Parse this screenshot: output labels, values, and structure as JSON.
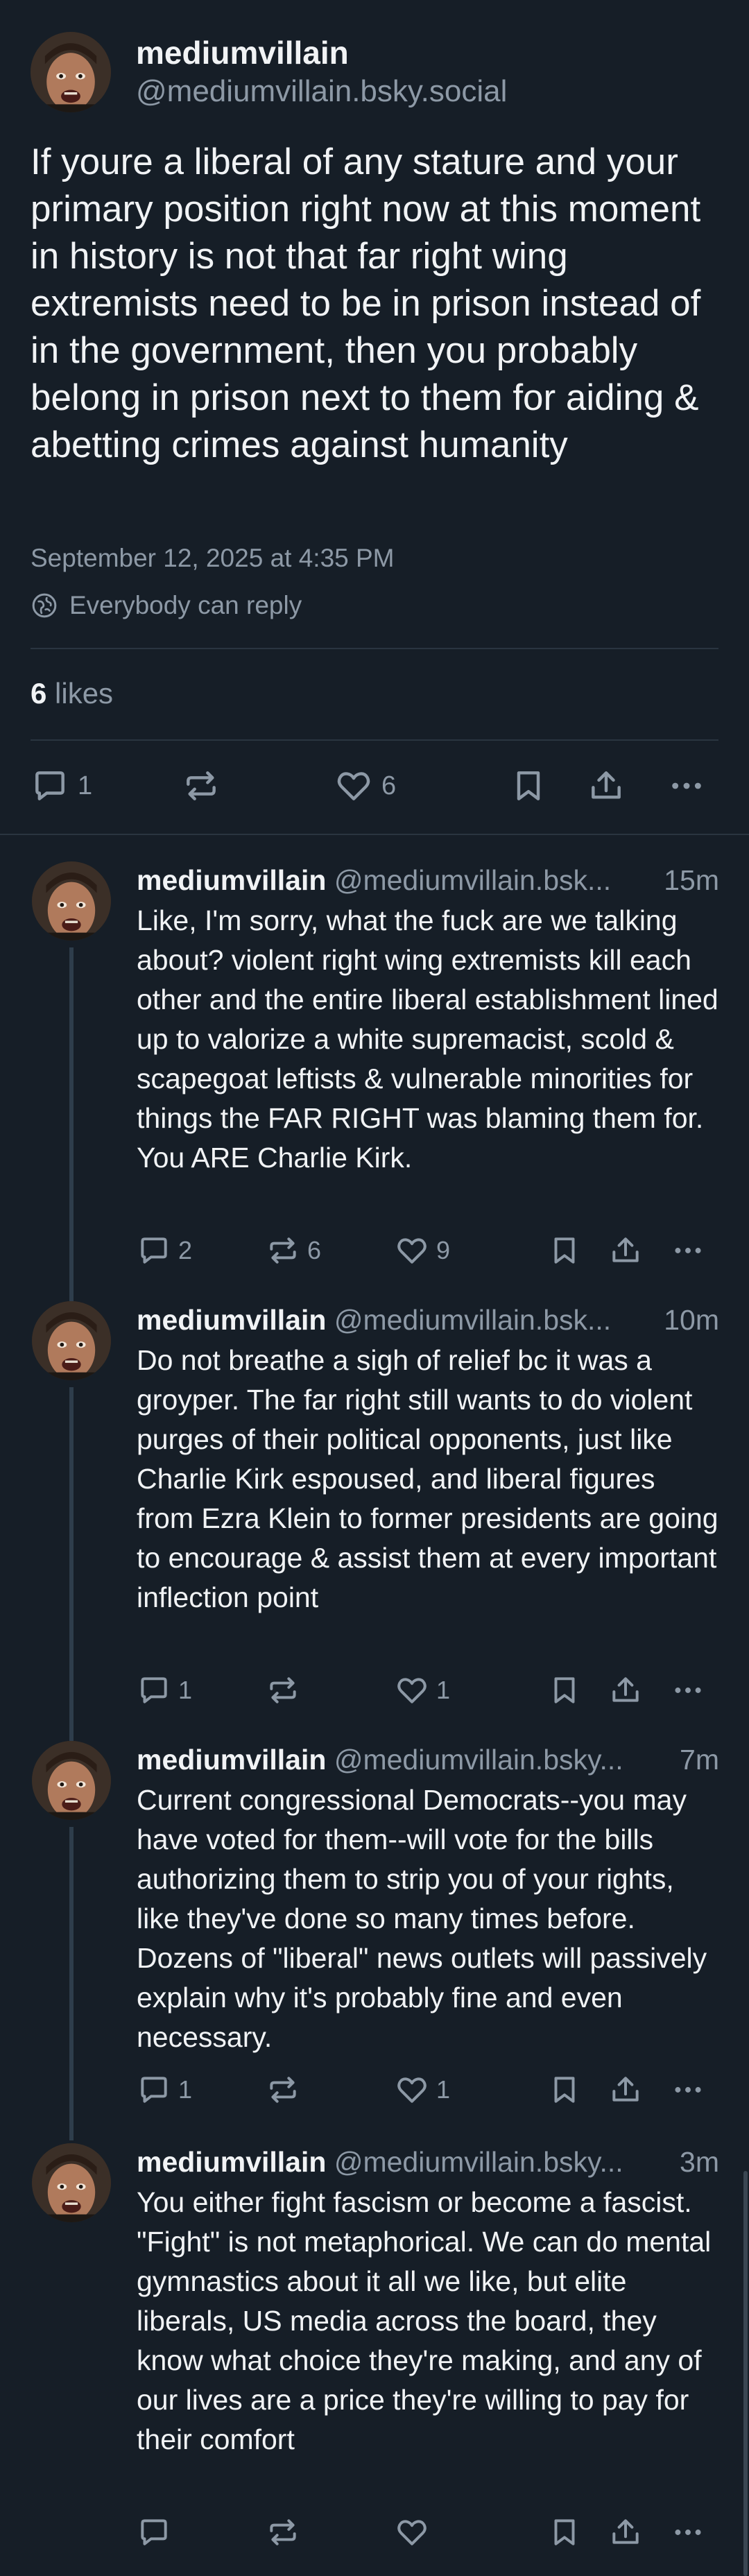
{
  "main_post": {
    "display_name": "mediumvillain",
    "handle": "@mediumvillain.bsky.social",
    "text": "If youre a liberal of any stature and your primary position right now at this moment in history is not that far right wing extremists need to be in prison instead of in the government, then you probably belong in prison next to them for aiding & abetting crimes against humanity",
    "timestamp": "September 12, 2025 at 4:35 PM",
    "reply_setting": "Everybody can reply",
    "likes_count": "6",
    "likes_label": "likes",
    "actions": {
      "replies": "1",
      "reposts": "",
      "likes": "6"
    }
  },
  "replies": [
    {
      "display_name": "mediumvillain",
      "handle": "@mediumvillain.bsk...",
      "time": "15m",
      "text": "Like, I'm sorry, what the fuck are we talking about? violent right wing extremists kill each other and the entire liberal establishment lined up to valorize a white supremacist, scold & scapegoat leftists & vulnerable minorities for things the FAR RIGHT was blaming them for. You ARE Charlie Kirk.",
      "replies": "2",
      "reposts": "6",
      "likes": "9"
    },
    {
      "display_name": "mediumvillain",
      "handle": "@mediumvillain.bsk...",
      "time": "10m",
      "text": "Do not breathe a sigh of relief bc it was a groyper. The far right still wants to do violent purges of their political opponents, just like Charlie Kirk espoused, and liberal figures from Ezra Klein to former presidents are going to encourage & assist them at every important inflection point",
      "replies": "1",
      "reposts": "",
      "likes": "1"
    },
    {
      "display_name": "mediumvillain",
      "handle": "@mediumvillain.bsky...",
      "time": "7m",
      "text": "Current congressional Democrats--you may have voted for them--will vote for the bills authorizing them to strip you of your rights, like they've done so many times before. Dozens of \"liberal\" news outlets will passively explain why it's probably fine and even necessary.",
      "replies": "1",
      "reposts": "",
      "likes": "1"
    },
    {
      "display_name": "mediumvillain",
      "handle": "@mediumvillain.bsky...",
      "time": "3m",
      "text": "You either fight fascism or become a fascist. \"Fight\" is not metaphorical. We can do mental gymnastics about it all we like, but elite liberals, US media across the board, they know what choice they're making, and any of our lives are a price they're willing to pay for their comfort",
      "replies": "",
      "reposts": "",
      "likes": ""
    }
  ],
  "colors": {
    "background": "#161e27",
    "text": "#f1f3f5",
    "muted": "#8d99a6",
    "divider": "#2a3540",
    "thread_line": "#2e3d4b"
  },
  "icons": {
    "reply": "speech-bubble-icon",
    "repost": "repost-arrows-icon",
    "like": "heart-icon",
    "bookmark": "bookmark-icon",
    "share": "share-upload-icon",
    "more": "ellipsis-icon",
    "reply_setting": "globe-icon"
  }
}
